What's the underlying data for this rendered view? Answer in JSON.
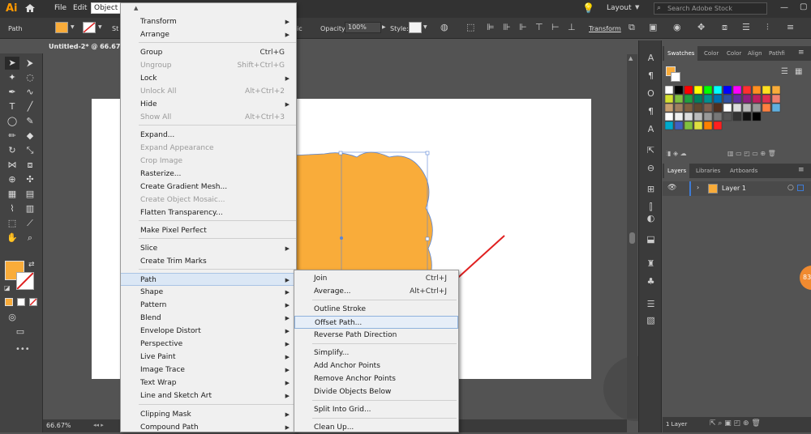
{
  "app": {
    "logo": "Ai"
  },
  "menubar": {
    "items": [
      "File",
      "Edit",
      "Object"
    ],
    "active": "Object",
    "layout_label": "Layout",
    "search_placeholder": "Search Adobe Stock"
  },
  "controlbar": {
    "selection_label": "Path",
    "opacity_label": "Opacity:",
    "opacity_value": "100%",
    "style_label": "Style:",
    "transform_button": "Transform",
    "partial_left": "St",
    "partial_right": "ic"
  },
  "document": {
    "tab_title": "Untitled-2* @ 66.67% ("
  },
  "status": {
    "zoom": "66.67%"
  },
  "colors": {
    "fill": "#F9AC3A",
    "accent": "#3d7bd6",
    "arrow": "#e02020"
  },
  "object_menu": {
    "items": [
      {
        "label": "Transform",
        "submenu": true
      },
      {
        "label": "Arrange",
        "submenu": true
      },
      {
        "label": "Group",
        "shortcut": "Ctrl+G"
      },
      {
        "label": "Ungroup",
        "shortcut": "Shift+Ctrl+G",
        "disabled": true
      },
      {
        "label": "Lock",
        "submenu": true
      },
      {
        "label": "Unlock All",
        "shortcut": "Alt+Ctrl+2",
        "disabled": true
      },
      {
        "label": "Hide",
        "submenu": true
      },
      {
        "label": "Show All",
        "shortcut": "Alt+Ctrl+3",
        "disabled": true
      },
      {
        "label": "Expand..."
      },
      {
        "label": "Expand Appearance",
        "disabled": true
      },
      {
        "label": "Crop Image",
        "disabled": true
      },
      {
        "label": "Rasterize..."
      },
      {
        "label": "Create Gradient Mesh..."
      },
      {
        "label": "Create Object Mosaic...",
        "disabled": true
      },
      {
        "label": "Flatten Transparency..."
      },
      {
        "label": "Make Pixel Perfect"
      },
      {
        "label": "Slice",
        "submenu": true
      },
      {
        "label": "Create Trim Marks"
      },
      {
        "label": "Path",
        "submenu": true,
        "highlighted": true
      },
      {
        "label": "Shape",
        "submenu": true
      },
      {
        "label": "Pattern",
        "submenu": true
      },
      {
        "label": "Blend",
        "submenu": true
      },
      {
        "label": "Envelope Distort",
        "submenu": true
      },
      {
        "label": "Perspective",
        "submenu": true
      },
      {
        "label": "Live Paint",
        "submenu": true
      },
      {
        "label": "Image Trace",
        "submenu": true
      },
      {
        "label": "Text Wrap",
        "submenu": true
      },
      {
        "label": "Line and Sketch Art",
        "submenu": true
      },
      {
        "label": "Clipping Mask",
        "submenu": true
      },
      {
        "label": "Compound Path",
        "submenu": true
      }
    ]
  },
  "path_submenu": {
    "items": [
      {
        "label": "Join",
        "shortcut": "Ctrl+J"
      },
      {
        "label": "Average...",
        "shortcut": "Alt+Ctrl+J"
      },
      {
        "label": "Outline Stroke"
      },
      {
        "label": "Offset Path...",
        "highlighted": true
      },
      {
        "label": "Reverse Path Direction"
      },
      {
        "label": "Simplify..."
      },
      {
        "label": "Add Anchor Points"
      },
      {
        "label": "Remove Anchor Points"
      },
      {
        "label": "Divide Objects Below"
      },
      {
        "label": "Split Into Grid..."
      },
      {
        "label": "Clean Up..."
      }
    ]
  },
  "swatches_panel": {
    "tabs": [
      "Swatches",
      "Color",
      "Color",
      "Align",
      "Pathfi"
    ],
    "active": "Swatches"
  },
  "layers_panel": {
    "tabs": [
      "Layers",
      "Libraries",
      "Artboards"
    ],
    "active": "Layers",
    "layer_name": "Layer 1",
    "footer": "1 Layer"
  },
  "badge": {
    "text": "83"
  }
}
